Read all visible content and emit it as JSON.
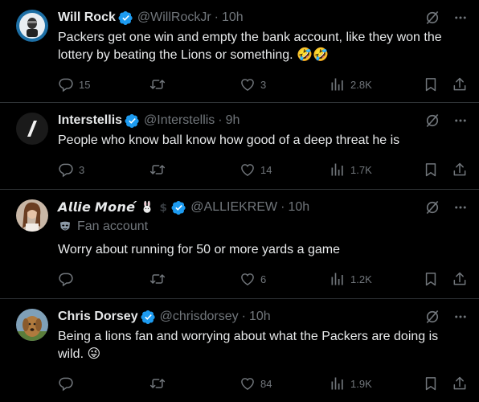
{
  "tweets": [
    {
      "name": "Will Rock",
      "handle": "@WillRockJr",
      "time": "10h",
      "text": "Packers get one win and empty the bank account, like they won the lottery by beating the Lions or something.",
      "emoji_suffix": "🤣🤣",
      "replies": "15",
      "retweets": "",
      "likes": "3",
      "views": "2.8K"
    },
    {
      "name": "Interstellis",
      "handle": "@Interstellis",
      "time": "9h",
      "text": "People who know ball know how good of a deep threat he is",
      "replies": "3",
      "retweets": "",
      "likes": "14",
      "views": "1.7K"
    },
    {
      "name": "𝘼𝙡𝙡𝙞𝙚 𝙈𝙤𝙣𝙚́",
      "handle": "@ALLIEKREW",
      "time": "10h",
      "subtitle": "Fan account",
      "text": "Worry about running for 50 or more yards a game",
      "replies": "",
      "retweets": "",
      "likes": "6",
      "views": "1.2K"
    },
    {
      "name": "Chris Dorsey",
      "handle": "@chrisdorsey",
      "time": "10h",
      "text": "Being a lions fan and worrying about what the Packers are doing is wild.",
      "emoji_suffix": "😜",
      "replies": "",
      "retweets": "",
      "likes": "84",
      "views": "1.9K"
    }
  ],
  "colors": {
    "background": "#000000",
    "text": "#e7e9ea",
    "muted": "#71767b",
    "verified": "#1d9bf0",
    "divider": "#2f3336"
  },
  "icons": [
    "verified-badge-icon",
    "grok-icon",
    "more-icon",
    "reply-icon",
    "retweet-icon",
    "like-icon",
    "views-icon",
    "bookmark-icon",
    "share-icon",
    "mask-icon"
  ]
}
